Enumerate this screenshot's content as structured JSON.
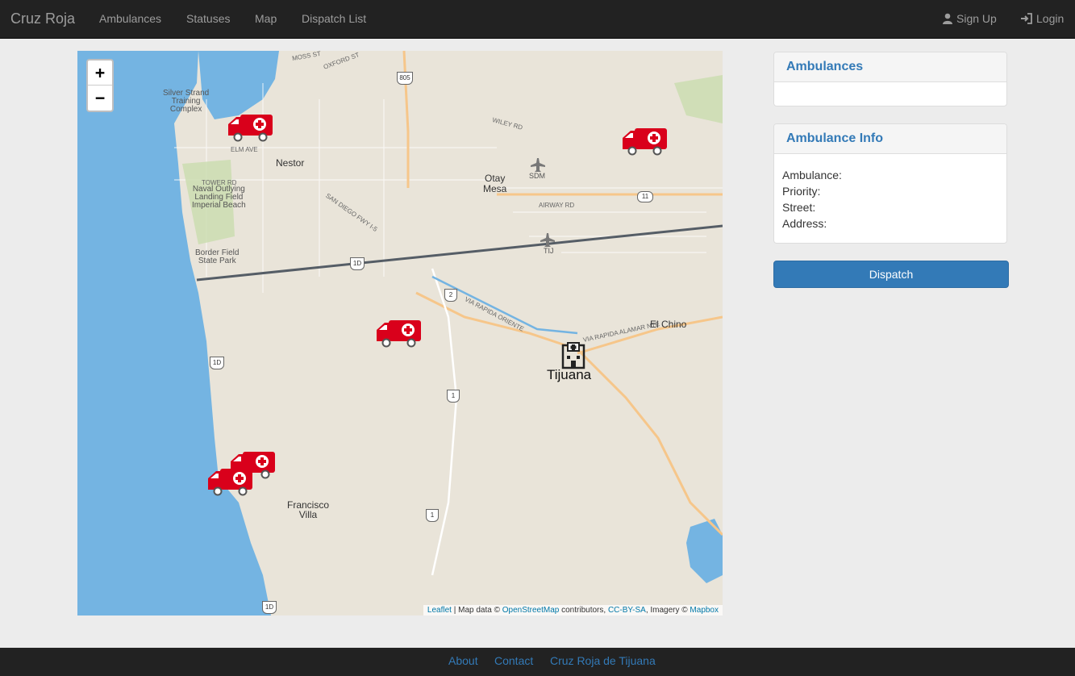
{
  "navbar": {
    "brand": "Cruz Roja",
    "items": [
      "Ambulances",
      "Statuses",
      "Map",
      "Dispatch List"
    ],
    "signup": "Sign Up",
    "login": "Login"
  },
  "map": {
    "zoom_in": "+",
    "zoom_out": "−",
    "labels": {
      "silver_strand": "Silver Strand\nTraining\nComplex",
      "nestor": "Nestor",
      "otay_mesa": "Otay\nMesa",
      "sdm": "SDM",
      "tij": "TIJ",
      "naval": "Naval Outlying\nLanding Field\nImperial Beach",
      "border_field": "Border Field\nState Park",
      "el_chino": "El Chino",
      "tijuana": "Tijuana",
      "francisco_villa": "Francisco\nVilla",
      "tower_rd": "TOWER RD",
      "elm_ave": "ELM AVE",
      "wiley_rd": "WILEY RD",
      "airway_rd": "AIRWAY RD",
      "oxford_st": "OXFORD ST",
      "moss_st": "MOSS ST",
      "via_rapida": "VIA RAPIDA ORIENTE",
      "via_alamar": "VIA RAPIDA ALAMAR NTE",
      "sd_fwy": "SAN DIEGO FWY I-5",
      "shield_805": "805",
      "shield_11": "11",
      "shield_1d": "1D",
      "shield_2": "2",
      "shield_1": "1"
    },
    "attribution": {
      "leaflet": "Leaflet",
      "mid": " | Map data © ",
      "osm": "OpenStreetMap",
      "contrib": " contributors, ",
      "license": "CC-BY-SA",
      "imagery": ", Imagery © ",
      "mapbox": "Mapbox"
    }
  },
  "panels": {
    "ambulances_title": "Ambulances",
    "info_title": "Ambulance Info",
    "info_fields": {
      "ambulance": "Ambulance:",
      "priority": "Priority:",
      "street": "Street:",
      "address": "Address:"
    }
  },
  "dispatch_label": "Dispatch",
  "footer": {
    "about": "About",
    "contact": "Contact",
    "org": "Cruz Roja de Tijuana"
  },
  "colors": {
    "navbar": "#222222",
    "link": "#337ab7",
    "ambulance": "#d9001b",
    "water": "#74b4e2"
  }
}
